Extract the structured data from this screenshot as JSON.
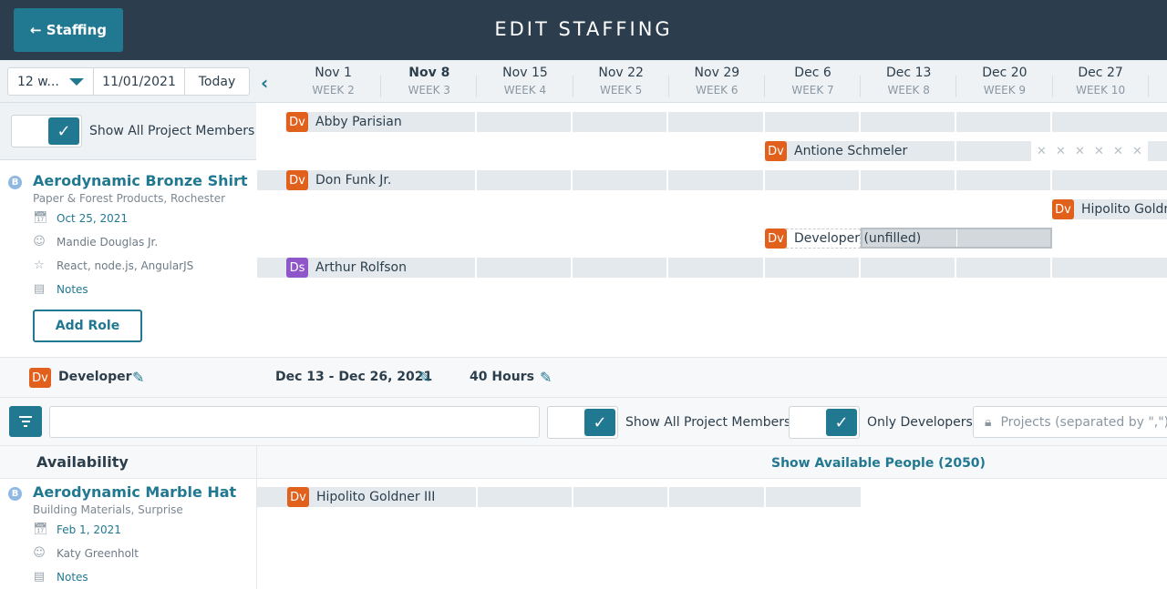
{
  "header": {
    "back_label": "← Staffing",
    "title": "EDIT STAFFING"
  },
  "controls": {
    "range": "12 w...",
    "start_date": "11/01/2021",
    "today_label": "Today"
  },
  "weeks": [
    {
      "date": "Nov 1",
      "week": "WEEK 2",
      "current": false
    },
    {
      "date": "Nov 8",
      "week": "WEEK 3",
      "current": true
    },
    {
      "date": "Nov 15",
      "week": "WEEK 4",
      "current": false
    },
    {
      "date": "Nov 22",
      "week": "WEEK 5",
      "current": false
    },
    {
      "date": "Nov 29",
      "week": "WEEK 6",
      "current": false
    },
    {
      "date": "Dec 6",
      "week": "WEEK 7",
      "current": false
    },
    {
      "date": "Dec 13",
      "week": "WEEK 8",
      "current": false
    },
    {
      "date": "Dec 20",
      "week": "WEEK 9",
      "current": false
    },
    {
      "date": "Dec 27",
      "week": "WEEK 10",
      "current": false
    }
  ],
  "top_toggle": {
    "label": "Show All Project Members",
    "checked": true
  },
  "project": {
    "badge": "B",
    "name": "Aerodynamic Bronze Shirt",
    "industry": "Paper & Forest Products, Rochester",
    "date": "Oct 25, 2021",
    "manager": "Mandie Douglas Jr.",
    "skills": "React, node.js, AngularJS",
    "notes_label": "Notes",
    "add_role_label": "Add Role"
  },
  "assignments": [
    {
      "tag": "Dv",
      "name": "Abby Parisian",
      "role_color": "#e0601c"
    },
    {
      "tag": "Dv",
      "name": "Antione Schmeler",
      "role_color": "#e0601c"
    },
    {
      "tag": "Dv",
      "name": "Don Funk Jr.",
      "role_color": "#e0601c"
    },
    {
      "tag": "Dv",
      "name": "Hipolito Goldn",
      "role_color": "#e0601c"
    },
    {
      "tag": "Dv",
      "name": "Developer (unfilled)",
      "role_color": "#e0601c"
    },
    {
      "tag": "Ds",
      "name": "Arthur Rolfson",
      "role_color": "#8e56c9"
    }
  ],
  "role_editor": {
    "tag": "Dv",
    "role": "Developer",
    "date_range": "Dec 13 - Dec 26, 2021",
    "hours": "40 Hours"
  },
  "filters": {
    "search_value": "",
    "show_all_label": "Show All Project Members",
    "show_all_checked": true,
    "only_devs_label": "Only Developers",
    "only_devs_checked": true,
    "projects_placeholder": "Projects (separated by \",\")"
  },
  "availability": {
    "title": "Availability",
    "show_available_label": "Show Available People (2050)",
    "project": {
      "badge": "B",
      "name": "Aerodynamic Marble Hat",
      "industry": "Building Materials, Surprise",
      "date": "Feb 1, 2021",
      "manager": "Katy Greenholt",
      "notes_label": "Notes"
    },
    "people": [
      {
        "tag": "Dv",
        "name": "Hipolito Goldner III"
      }
    ]
  },
  "colors": {
    "accent": "#217891",
    "topbar": "#2c3e4d",
    "developer": "#e0601c",
    "designer": "#8e56c9"
  }
}
